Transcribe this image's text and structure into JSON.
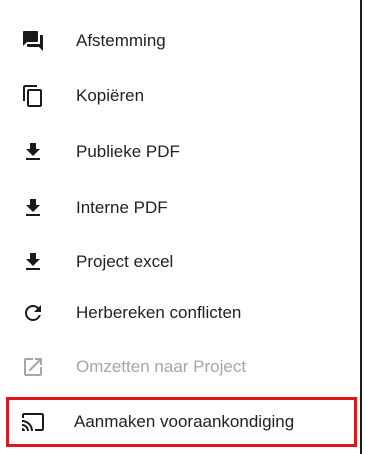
{
  "menu": {
    "items": [
      {
        "label": "Afstemming",
        "icon": "forum-icon",
        "enabled": true
      },
      {
        "label": "Kopiëren",
        "icon": "copy-icon",
        "enabled": true
      },
      {
        "label": "Publieke PDF",
        "icon": "download-icon",
        "enabled": true
      },
      {
        "label": "Interne PDF",
        "icon": "download-icon",
        "enabled": true
      },
      {
        "label": "Project excel",
        "icon": "download-icon",
        "enabled": true
      },
      {
        "label": "Herbereken conflicten",
        "icon": "refresh-icon",
        "enabled": true
      },
      {
        "label": "Omzetten naar Project",
        "icon": "open-in-new-icon",
        "enabled": false
      },
      {
        "label": "Aanmaken vooraankondiging",
        "icon": "cast-icon",
        "enabled": true,
        "highlighted": true
      }
    ]
  },
  "colors": {
    "text": "#222222",
    "icon": "#1a1a1a",
    "disabled": "#a6a6a6",
    "highlight_border": "#e0161e"
  }
}
